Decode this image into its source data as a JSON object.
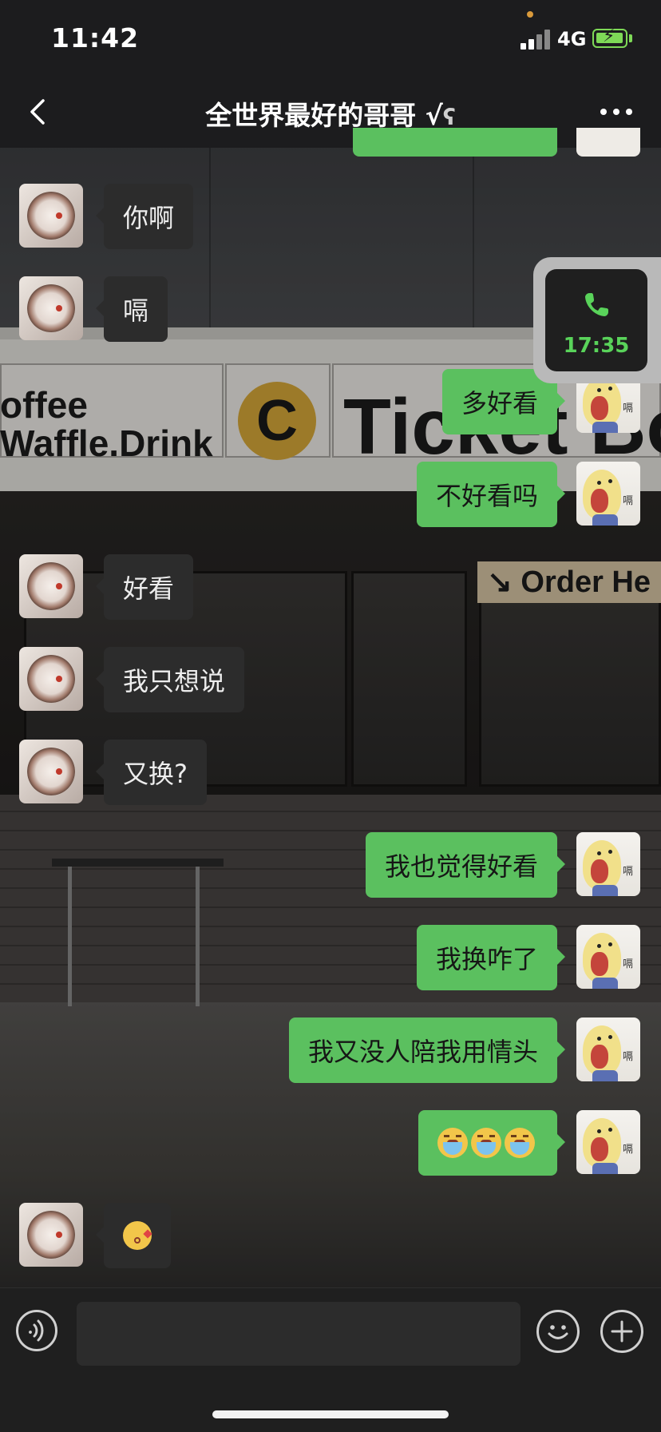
{
  "status_bar": {
    "time": "11:42",
    "network": "4G"
  },
  "header": {
    "title": "全世界最好的哥哥 √",
    "ear_glyph": "ʕ",
    "back_icon": "chevron-left-icon",
    "more_icon": "more-dots-icon"
  },
  "background_sign": {
    "left_line1": "offee",
    "left_line2": "Waffle.Drink",
    "badge": "C",
    "right_text": "Ticket Bo",
    "order_text": "↘ Order He"
  },
  "call_widget": {
    "duration": "17:35",
    "icon": "phone-icon",
    "color": "#59d35a"
  },
  "messages": [
    {
      "side": "left",
      "text": "你啊"
    },
    {
      "side": "left",
      "text": "嗝"
    },
    {
      "side": "right",
      "text": "多好看"
    },
    {
      "side": "right",
      "text": "不好看吗"
    },
    {
      "side": "left",
      "text": "好看"
    },
    {
      "side": "left",
      "text": "我只想说"
    },
    {
      "side": "left",
      "text": "又换?"
    },
    {
      "side": "right",
      "text": "我也觉得好看"
    },
    {
      "side": "right",
      "text": "我换咋了"
    },
    {
      "side": "right",
      "text": "我又没人陪我用情头"
    },
    {
      "side": "right",
      "emoji": [
        "crying-face-emoji",
        "crying-face-emoji",
        "crying-face-emoji"
      ]
    },
    {
      "side": "left",
      "emoji": [
        "kissing-face-emoji"
      ]
    }
  ],
  "avatar_right_tag": "嗝",
  "input_bar": {
    "voice_icon": "voice-icon",
    "emoji_icon": "smiley-icon",
    "plus_icon": "plus-icon",
    "placeholder": ""
  },
  "colors": {
    "sent_bubble": "#5bc05f",
    "received_bubble": "#2c2c2c",
    "bar_bg": "#1c1c1e"
  }
}
